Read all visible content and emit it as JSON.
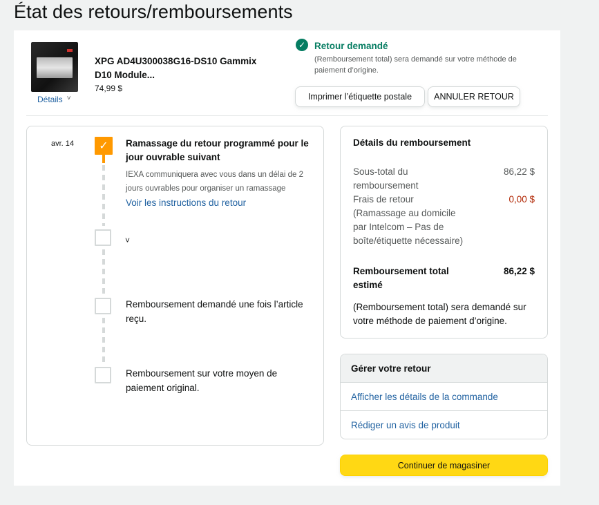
{
  "page": {
    "title": "État des retours/remboursements"
  },
  "product": {
    "name": "XPG AD4U300038G16-DS10 Gammix D10 Module...",
    "price": "74,99 $",
    "details_label": "Détails",
    "details_chevron": "˅"
  },
  "status": {
    "icon": "✓",
    "title": "Retour demandé",
    "description": "(Remboursement total) sera demandé sur votre méthode de paiement d’origine.",
    "color": "#067d62"
  },
  "actions": {
    "print_label": "Imprimer l’étiquette postale",
    "cancel_label": "ANNULER RETOUR"
  },
  "timeline": {
    "date": "avr. 14",
    "done_icon": "✓",
    "step1_title": "Ramassage du retour programmé pour le jour ouvrable suivant",
    "step1_desc": "IEXA communiquera avec vous dans un délai de 2 jours ouvrables pour organiser un ramassage",
    "step1_link": "Voir les instructions du retour",
    "expand_icon": "˅",
    "step3": "Remboursement demandé une fois l’article reçu.",
    "step4": "Remboursement sur votre moyen de paiement original."
  },
  "refund": {
    "heading": "Détails du remboursement",
    "subtotal_label": "Sous-total du remboursement",
    "subtotal_value": "86,22 $",
    "fee_label": "Frais de retour (Ramassage au domicile par Intelcom – Pas de boîte/étiquette nécessaire)",
    "fee_value": "0,00 $",
    "total_label": "Remboursement total estimé",
    "total_value": "86,22 $",
    "note": "(Remboursement total) sera demandé sur votre méthode de paiement d’origine."
  },
  "manage": {
    "heading": "Gérer votre retour",
    "items": [
      {
        "label": "Afficher les détails de la commande"
      },
      {
        "label": "Rédiger un avis de produit"
      }
    ]
  },
  "continue": {
    "label": "Continuer de magasiner",
    "color": "#ffd814"
  },
  "colors": {
    "accent_orange": "#ff9900",
    "link": "#2162a1",
    "fee_red": "#b12704"
  }
}
